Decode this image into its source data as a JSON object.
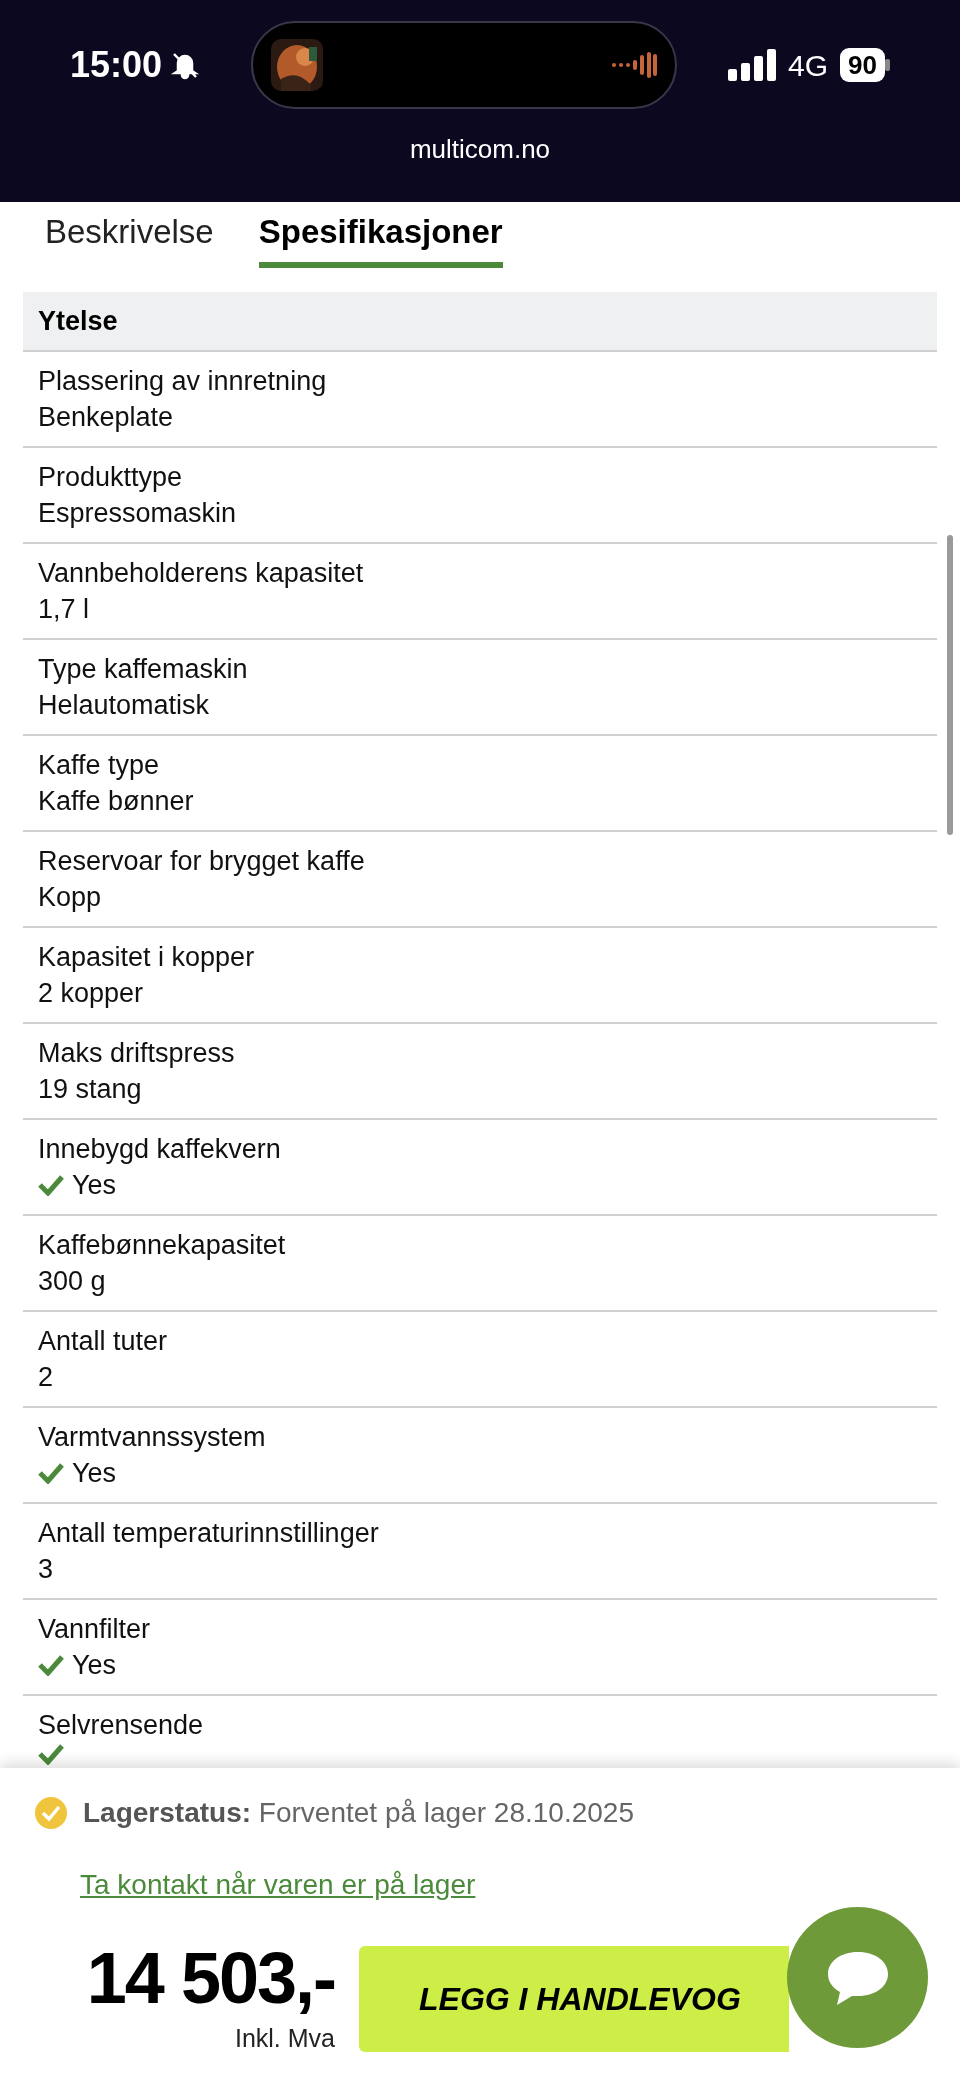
{
  "status_bar": {
    "time": "15:00",
    "network": "4G",
    "battery": "90"
  },
  "browser": {
    "url": "multicom.no"
  },
  "tabs": [
    {
      "label": "Beskrivelse",
      "selected": false
    },
    {
      "label": "Spesifikasjoner",
      "selected": true
    }
  ],
  "section": {
    "title": "Ytelse"
  },
  "specs": [
    {
      "label": "Plassering av innretning",
      "kind": "text",
      "value": "Benkeplate"
    },
    {
      "label": "Produkttype",
      "kind": "text",
      "value": "Espressomaskin"
    },
    {
      "label": "Vannbeholderens kapasitet",
      "kind": "text",
      "value": "1,7 l"
    },
    {
      "label": "Type kaffemaskin",
      "kind": "text",
      "value": "Helautomatisk"
    },
    {
      "label": "Kaffe type",
      "kind": "text",
      "value": "Kaffe bønner"
    },
    {
      "label": "Reservoar for brygget kaffe",
      "kind": "text",
      "value": "Kopp"
    },
    {
      "label": "Kapasitet i kopper",
      "kind": "text",
      "value": "2 kopper"
    },
    {
      "label": "Maks driftspress",
      "kind": "text",
      "value": "19 stang"
    },
    {
      "label": "Innebygd kaffekvern",
      "kind": "check",
      "value": "Yes"
    },
    {
      "label": "Kaffebønnekapasitet",
      "kind": "text",
      "value": "300 g"
    },
    {
      "label": "Antall tuter",
      "kind": "text",
      "value": "2"
    },
    {
      "label": "Varmtvannssystem",
      "kind": "check",
      "value": "Yes"
    },
    {
      "label": "Antall temperaturinnstillinger",
      "kind": "text",
      "value": "3"
    },
    {
      "label": "Vannfilter",
      "kind": "check",
      "value": "Yes"
    },
    {
      "label": "Selvrensende",
      "kind": "check"
    }
  ],
  "stock": {
    "status": "**Lagerstatus:** Forventet på lager 28.10.2025",
    "link": "Ta kontakt når varen er på lager"
  },
  "price": {
    "amount": "14 503,-",
    "note": "Inkl. Mva"
  },
  "cart_button": {
    "label": "LEGG I HANDLEVOG"
  }
}
